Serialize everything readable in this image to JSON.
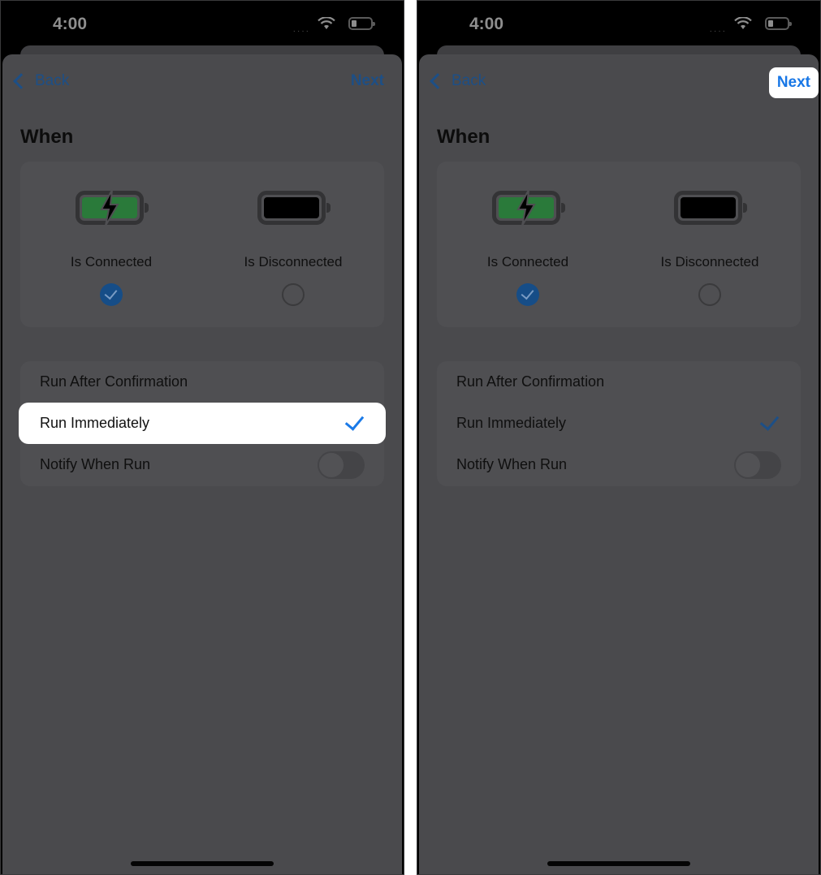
{
  "screens": [
    {
      "status": {
        "time": "4:00",
        "signal": "····"
      },
      "nav": {
        "back_label": "Back",
        "next_label": "Next",
        "next_highlighted": false
      },
      "title": "When",
      "trigger_options": [
        {
          "label": "Is Connected",
          "icon": "battery-charging-icon",
          "selected": true
        },
        {
          "label": "Is Disconnected",
          "icon": "battery-full-icon",
          "selected": false
        }
      ],
      "run_options": [
        {
          "label": "Run After Confirmation",
          "checked": false
        },
        {
          "label": "Run Immediately",
          "checked": true,
          "highlighted": true
        },
        {
          "label": "Notify When Run",
          "toggle": false
        }
      ]
    },
    {
      "status": {
        "time": "4:00",
        "signal": "····"
      },
      "nav": {
        "back_label": "Back",
        "next_label": "Next",
        "next_highlighted": true
      },
      "title": "When",
      "trigger_options": [
        {
          "label": "Is Connected",
          "icon": "battery-charging-icon",
          "selected": true
        },
        {
          "label": "Is Disconnected",
          "icon": "battery-full-icon",
          "selected": false
        }
      ],
      "run_options": [
        {
          "label": "Run After Confirmation",
          "checked": false
        },
        {
          "label": "Run Immediately",
          "checked": true
        },
        {
          "label": "Notify When Run",
          "toggle": false
        }
      ]
    }
  ],
  "colors": {
    "accent": "#1877e6",
    "dim_accent": "#1d4f86",
    "battery_green": "#2a7a3a",
    "overlay": "#4a4a4d"
  }
}
